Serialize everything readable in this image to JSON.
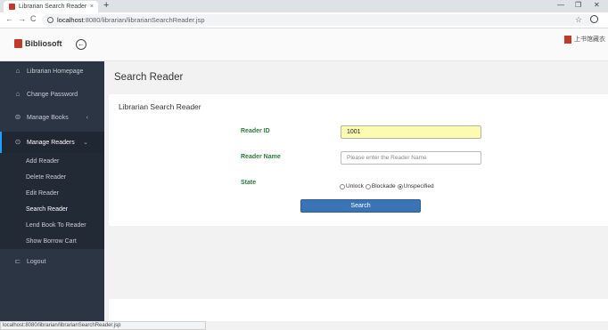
{
  "browser": {
    "tab_title": "Librarian Search Reader",
    "tab_close": "×",
    "new_tab": "+",
    "url_host": "localhost",
    "url_path": ":8080/librarian/librarianSearchReader.jsp",
    "back": "←",
    "forward": "→",
    "reload": "C",
    "star": "☆",
    "minimize": "—",
    "maximize": "❐",
    "close": "✕"
  },
  "header": {
    "logo_text": "Bibliosoft",
    "back_button": "←",
    "right_text": "上书馆藏衣"
  },
  "sidebar": {
    "items": [
      {
        "label": "Librarian Homepage",
        "icon": "home-icon",
        "glyph": "⌂"
      },
      {
        "label": "Change Password",
        "icon": "home-icon",
        "glyph": "⌂"
      },
      {
        "label": "Manage Books",
        "icon": "book-circle-icon",
        "glyph": "⊜",
        "caret": "‹"
      },
      {
        "label": "Manage Readers",
        "icon": "reader-circle-icon",
        "glyph": "⊙",
        "caret": "⌄"
      }
    ],
    "submenu": [
      "Add Reader",
      "Delete Reader",
      "Edit Reader",
      "Search Reader",
      "Lend Book To Reader",
      "Show Borrow Cart"
    ],
    "logout": {
      "label": "Logout",
      "icon": "logout-icon",
      "glyph": "⊏"
    }
  },
  "main": {
    "page_title": "Search Reader",
    "card_title": "Librarian Search Reader",
    "fields": {
      "reader_id_label": "Reader ID",
      "reader_id_value": "1001",
      "reader_name_label": "Reader Name",
      "reader_name_placeholder": "Please enter the Reader Name",
      "state_label": "State",
      "state_options": [
        "Unlock",
        "Blockade",
        "Unspecified"
      ],
      "state_selected": "Unspecified"
    },
    "search_button": "Search"
  },
  "status_bar": "localhost:8080/librarian/librarianSearchReader.jsp",
  "colors": {
    "sidebar_bg": "#2b3544",
    "accent": "#1e9fff",
    "button": "#3a74b4",
    "label_green": "#2a7a3b",
    "input_highlight": "#fbfbb2"
  }
}
